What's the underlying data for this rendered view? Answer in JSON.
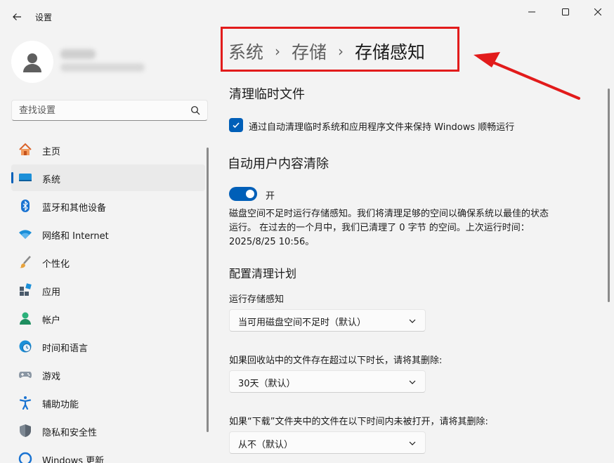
{
  "window": {
    "title": "设置",
    "controls": [
      "minimize-icon",
      "maximize-icon",
      "close-icon"
    ]
  },
  "search": {
    "placeholder": "查找设置"
  },
  "sidebar": {
    "items": [
      {
        "label": "主页",
        "icon": "home-icon",
        "selected": false
      },
      {
        "label": "系统",
        "icon": "system-display-icon",
        "selected": true
      },
      {
        "label": "蓝牙和其他设备",
        "icon": "bluetooth-icon",
        "selected": false
      },
      {
        "label": "网络和 Internet",
        "icon": "wifi-icon",
        "selected": false
      },
      {
        "label": "个性化",
        "icon": "brush-icon",
        "selected": false
      },
      {
        "label": "应用",
        "icon": "apps-icon",
        "selected": false
      },
      {
        "label": "帐户",
        "icon": "account-icon",
        "selected": false
      },
      {
        "label": "时间和语言",
        "icon": "clock-globe-icon",
        "selected": false
      },
      {
        "label": "游戏",
        "icon": "gamepad-icon",
        "selected": false
      },
      {
        "label": "辅助功能",
        "icon": "accessibility-icon",
        "selected": false
      },
      {
        "label": "隐私和安全性",
        "icon": "shield-icon",
        "selected": false
      },
      {
        "label": "Windows 更新",
        "icon": "update-icon",
        "selected": false
      }
    ]
  },
  "breadcrumb": {
    "items": [
      "系统",
      "存储"
    ],
    "current": "存储感知",
    "separator": "›"
  },
  "sections": {
    "temp_files": {
      "title": "清理临时文件",
      "checkbox_label": "通过自动清理临时系统和应用程序文件来保持 Windows 顺畅运行",
      "checked": true
    },
    "auto_cleanup": {
      "title": "自动用户内容清除",
      "toggle_state": "开",
      "toggle_on": true,
      "description": "磁盘空间不足时运行存储感知。我们将清理足够的空间以确保系统以最佳的状态运行。 在过去的一个月中，我们已清理了 0 字节 的空间。上次运行时间：2025/8/25 10:56。"
    },
    "schedule": {
      "title": "配置清理计划",
      "run_label": "运行存储感知",
      "run_value": "当可用磁盘空间不足时（默认）",
      "recycle_label": "如果回收站中的文件存在超过以下时长，请将其删除:",
      "recycle_value": "30天（默认）",
      "downloads_label": "如果“下载”文件夹中的文件在以下时间内未被打开，请将其删除:",
      "downloads_value": "从不（默认）"
    }
  },
  "colors": {
    "accent": "#005fb8",
    "highlight_border": "#e21b1b",
    "background": "#f3f3f3"
  }
}
